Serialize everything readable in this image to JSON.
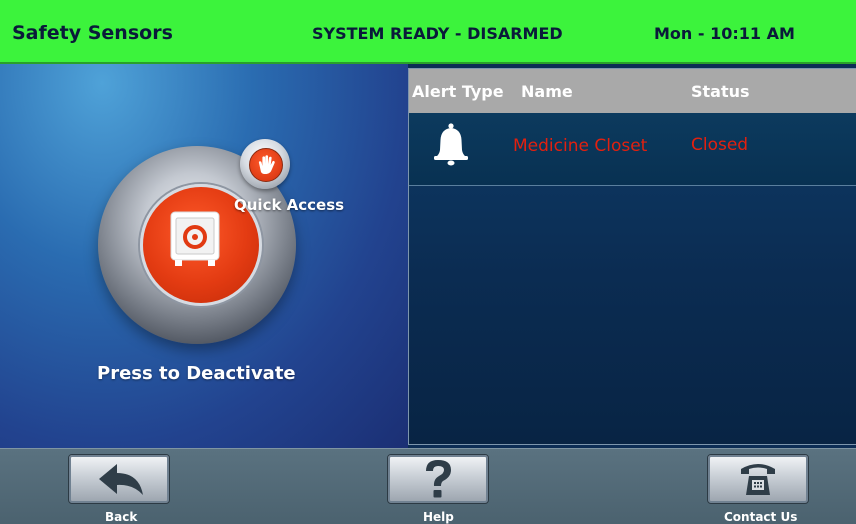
{
  "header": {
    "title": "Safety Sensors",
    "status": "SYSTEM READY - DISARMED",
    "clock": "Mon - 10:11 AM",
    "color": "#3cf33c"
  },
  "left": {
    "quick_access_label": "Quick Access",
    "press_label": "Press to Deactivate",
    "main_icon": "safe-icon",
    "quick_icon": "hand-icon"
  },
  "table": {
    "columns": [
      "Alert Type",
      "Name",
      "Status"
    ],
    "rows": [
      {
        "alert_icon": "bell-icon",
        "name": "Medicine Closet",
        "status": "Closed",
        "text_color": "#e2200f"
      }
    ]
  },
  "footer": {
    "back": {
      "label": "Back",
      "icon": "back-arrow-icon"
    },
    "help": {
      "label": "Help",
      "icon": "question-mark-icon"
    },
    "contact": {
      "label": "Contact Us",
      "icon": "telephone-icon"
    }
  }
}
